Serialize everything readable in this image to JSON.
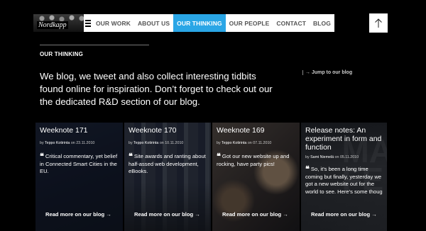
{
  "header": {
    "logo_text": "Nordkapp",
    "nav": [
      {
        "label": "OUR WORK",
        "active": false
      },
      {
        "label": "ABOUT US",
        "active": false
      },
      {
        "label": "OUR THINKING",
        "active": true
      },
      {
        "label": "OUR PEOPLE",
        "active": false
      },
      {
        "label": "CONTACT",
        "active": false
      },
      {
        "label": "BLOG",
        "active": false
      }
    ],
    "menu_icon": "hamburger-icon",
    "up_icon": "arrow-up-icon"
  },
  "section": {
    "title": "OUR THINKING",
    "intro": "We blog, we tweet and also collect interesting tidbits found online for inspiration. Don’t forget to check out our the dedicated R&D section of our blog.",
    "jump_link": "→ Jump to our blog"
  },
  "posts": [
    {
      "title": "Weeknote 171",
      "byline_prefix": "by",
      "author": "Teppo Kotirinta",
      "on": "on",
      "date": "23.11.2010",
      "quote": "Critical commentary, yet belief in Connected Smart Cities in the EU.",
      "read_more": "Read more on our blog →"
    },
    {
      "title": "Weeknote 170",
      "byline_prefix": "by",
      "author": "Teppo Kotirinta",
      "on": "on",
      "date": "10.11.2010",
      "quote": "Site awards and ranting about half-assed web development, eBooks.",
      "read_more": "Read more on our blog →"
    },
    {
      "title": "Weeknote 169",
      "byline_prefix": "by",
      "author": "Teppo Kotirinta",
      "on": "on",
      "date": "07.11.2010",
      "quote": "Got our new website up and rocking, have party pics!",
      "read_more": "Read more on our blog →"
    },
    {
      "title": "Release notes: An experiment in form and function",
      "byline_prefix": "by",
      "author": "Sami Niemelä",
      "on": "on",
      "date": "05.11.2010",
      "quote": "So, it's been a long time coming but finally, yesterday we got a new website out for the world to see. Here's some thoug",
      "read_more": "Read more on our blog →"
    }
  ],
  "colors": {
    "background": "#000000",
    "accent": "#2aa6e6",
    "nav_text": "#555555"
  }
}
